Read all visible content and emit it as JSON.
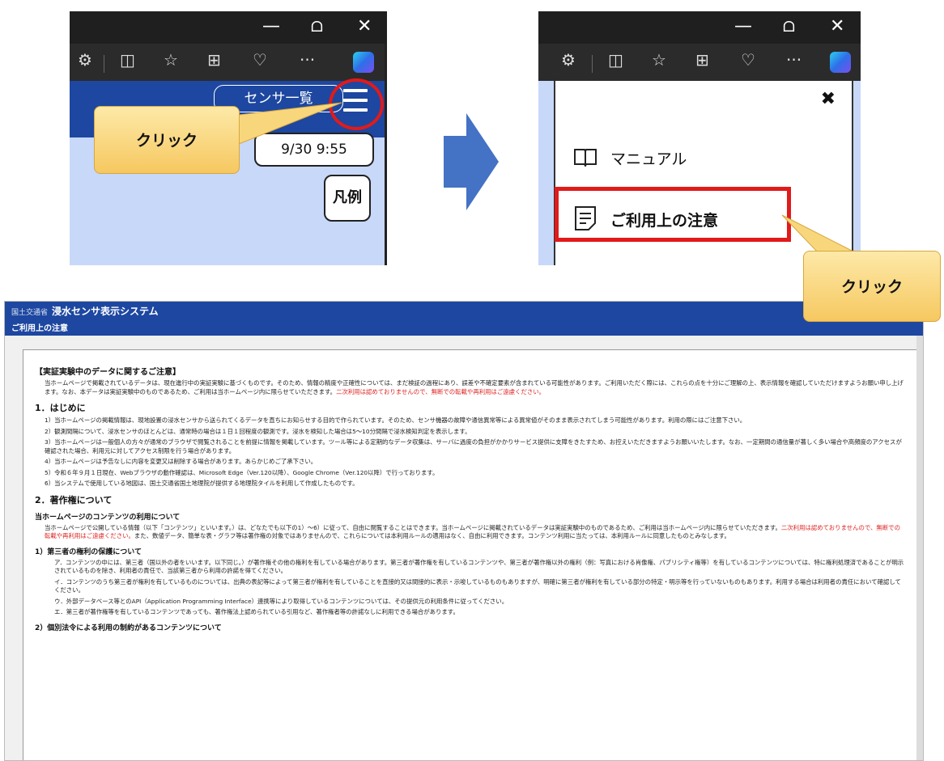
{
  "panel1": {
    "window_controls": {
      "minimize": "—",
      "restore": "ᗝ",
      "close": "✕"
    },
    "toolbar_icons": [
      "extensions-icon",
      "split-screen-icon",
      "favorites-icon",
      "collections-icon",
      "browser-essentials-icon",
      "more-icon",
      "copilot-icon"
    ],
    "more_label": "···",
    "sensor_list_button": "センサ一覧",
    "datetime": "9/30 9:55",
    "legend_button": "凡例",
    "callout": "クリック"
  },
  "panel2": {
    "window_controls": {
      "minimize": "—",
      "restore": "ᗝ",
      "close": "✕"
    },
    "more_label": "···",
    "close_label": "✖",
    "menu_items": [
      {
        "label": "マニュアル",
        "icon": "book-icon"
      },
      {
        "label": "ご利用上の注意",
        "icon": "document-icon"
      }
    ],
    "callout": "クリック"
  },
  "colors": {
    "header_blue": "#1d47a0",
    "light_blue": "#c7d8f9",
    "highlight_red": "#e11a1a",
    "arrow_blue": "#4472c4",
    "callout_yellow": "#f6c860"
  },
  "bottom": {
    "logo": "国土交通省",
    "title": "浸水センサ表示システム",
    "subtitle": "ご利用上の注意",
    "notice_heading": "【実証実験中のデータに関するご注意】",
    "notice_text_1": "当ホームページで掲載されているデータは、現在進行中の実証実験に基づくものです。そのため、情報の精度や正確性については、まだ検証の過程にあり、誤差や不確定要素が含まれている可能性があります。ご利用いただく際には、これらの点を十分にご理解の上、表示情報を確認していただけますようお願い申し上げます。なお、本データは実証実験中のものであるため、ご利用は当ホームページ内に限らせていただきます。",
    "notice_text_red": "二次利用は認めておりませんので、無断での転載や再利用はご遠慮ください。",
    "sec1_heading": "1．はじめに",
    "sec1_items": [
      "1）当ホームページの掲載情報は、現地設置の浸水センサから送られてくるデータを直ちにお知らせする目的で作られています。そのため、センサ機器の故障や通信異常等による異常値がそのまま表示されてしまう可能性があります。利用の際にはご注意下さい。",
      "2）観測間隔について、浸水センサのほとんどは、通常時の場合は１日１回程度の観測です。浸水を検知した場合は5〜10分間隔で浸水検知判定を表示します。",
      "3）当ホームページは一般個人の方々が通常のブラウザで閲覧されることを前提に情報を掲載しています。ツール等による定期的なデータ収集は、サーバに過度の負担がかかりサービス提供に支障をきたすため、お控えいただきますようお願いいたします。なお、一定期間の通信量が著しく多い場合や高頻度のアクセスが確認された場合、利用元に対してアクセス制限を行う場合があります。",
      "4）当ホームページは予告なしに内容を変更又は削除する場合があります。あらかじめご了承下さい。",
      "5）令和６年９月１日現在、Webブラウザの動作確認は、Microsoft Edge（Ver.120以降）、Google Chrome（Ver.120以降）で行っております。",
      "6）当システムで使用している地図は、国土交通省国土地理院が提供する地理院タイルを利用して作成したものです。"
    ],
    "sec2_heading": "2．著作権について",
    "sec2_sub": "当ホームページのコンテンツの利用について",
    "sec2_text_1": "当ホームページで公開している情報（以下「コンテンツ」といいます。）は、どなたでも以下の1）〜6）に従って、自由に閲覧することはできます。当ホームページに掲載されているデータは実証実験中のものであるため、ご利用は当ホームページ内に限らせていただきます。",
    "sec2_text_red": "二次利用は認めておりませんので、無断での転載や再利用はご遠慮ください。",
    "sec2_text_2": "また、数値データ、簡単な表・グラフ等は著作権の対象ではありませんので、これらについては本利用ルールの適用はなく、自由に利用できます。コンテンツ利用に当たっては、本利用ルールに同意したものとみなします。",
    "sub1_heading": "1）第三者の権利の保護について",
    "sub1_items": [
      "ア．コンテンツの中には、第三者（国以外の者をいいます。以下同じ。）が著作権その他の権利を有している場合があります。第三者が著作権を有しているコンテンツや、第三者が著作権以外の権利（例：写真における肖像権、パブリシティ権等）を有しているコンテンツについては、特に権利処理済であることが明示されているものを除き、利用者の責任で、当該第三者から利用の許諾を得てください。",
      "イ．コンテンツのうち第三者が権利を有しているものについては、出典の表記等によって第三者が権利を有していることを直接的又は間接的に表示・示唆しているものもありますが、明確に第三者が権利を有している部分の特定・明示等を行っていないものもあります。利用する場合は利用者の責任において確認してください。",
      "ウ．外部データベース等とのAPI（Application Programming Interface）連携等により取得しているコンテンツについては、その提供元の利用条件に従ってください。",
      "エ．第三者が著作権等を有しているコンテンツであっても、著作権法上認められている引用など、著作権者等の許諾なしに利用できる場合があります。"
    ],
    "sub2_heading": "2）個別法令による利用の制約があるコンテンツについて"
  }
}
